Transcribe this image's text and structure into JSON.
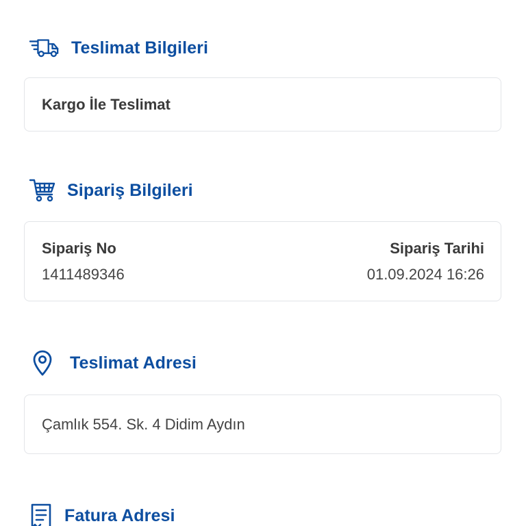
{
  "sections": {
    "delivery_info": {
      "title": "Teslimat Bilgileri",
      "icon": "delivery-truck-icon",
      "value": "Kargo İle Teslimat"
    },
    "order_info": {
      "title": "Sipariş Bilgileri",
      "icon": "shopping-cart-icon",
      "order_no_label": "Sipariş No",
      "order_no_value": "1411489346",
      "order_date_label": "Sipariş Tarihi",
      "order_date_value": "01.09.2024 16:26"
    },
    "delivery_address": {
      "title": "Teslimat Adresi",
      "icon": "location-pin-icon",
      "value": "Çamlık 554. Sk. 4 Didim Aydın"
    },
    "invoice_address": {
      "title": "Fatura Adresi",
      "icon": "receipt-icon"
    }
  },
  "colors": {
    "accent": "#0d4ea0",
    "card_border": "#e2e4e8",
    "text": "#3a3a3a"
  }
}
